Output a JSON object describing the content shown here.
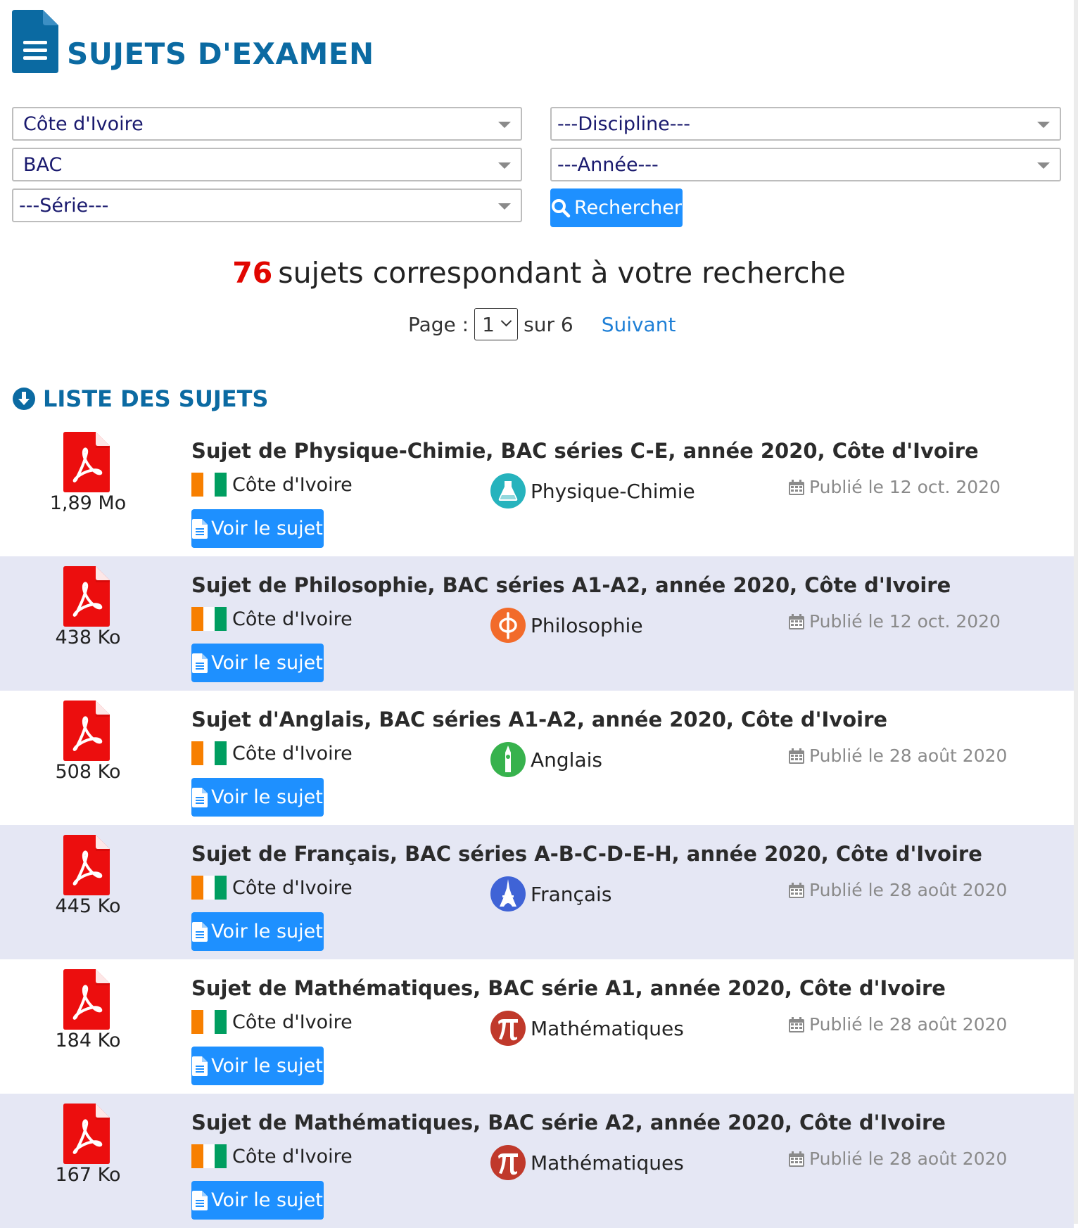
{
  "header": {
    "title": "SUJETS D'EXAMEN",
    "icon": "document-icon"
  },
  "filters": {
    "country": "Côte d'Ivoire",
    "exam": "BAC",
    "serie": "---Série---",
    "discipline": "---Discipline---",
    "annee": "---Année---",
    "search_label": "Recherche­r"
  },
  "results": {
    "count": "76",
    "text": "sujets correspondant à votre recherche"
  },
  "pager": {
    "label": "Page :",
    "current": "1",
    "of": "sur 6",
    "next": "Suivant"
  },
  "list": {
    "heading": "LISTE DES SUJETS",
    "view_label": "Voir le sujet"
  },
  "colors": {
    "primary": "#1e90ff",
    "title_blue": "#0b6aa2",
    "count_red": "#e10600",
    "alt_row": "#e5e7f4"
  },
  "items": [
    {
      "title": "Sujet de Physique-Chimie, BAC séries C-E, année 2020, Côte d'Ivoire",
      "size": "1,89 Mo",
      "country": "Côte d'Ivoire",
      "discipline": "Physique-Chimie",
      "discipline_icon": "flask-icon",
      "published": "Publié le 12 oct. 2020"
    },
    {
      "title": "Sujet de Philosophie, BAC séries A1-A2, année 2020, Côte d'Ivoire",
      "size": "438 Ko",
      "country": "Côte d'Ivoire",
      "discipline": "Philosophie",
      "discipline_icon": "phi-icon",
      "published": "Publié le 12 oct. 2020"
    },
    {
      "title": "Sujet d'Anglais, BAC séries A1-A2, année 2020, Côte d'Ivoire",
      "size": "508 Ko",
      "country": "Côte d'Ivoire",
      "discipline": "Anglais",
      "discipline_icon": "big-ben-icon",
      "published": "Publié le 28 août 2020"
    },
    {
      "title": "Sujet de Français, BAC séries A-B-C-D-E-H, année 2020, Côte d'Ivoire",
      "size": "445 Ko",
      "country": "Côte d'Ivoire",
      "discipline": "Français",
      "discipline_icon": "eiffel-tower-icon",
      "published": "Publié le 28 août 2020"
    },
    {
      "title": "Sujet de Mathématiques, BAC série A1, année 2020, Côte d'Ivoire",
      "size": "184 Ko",
      "country": "Côte d'Ivoire",
      "discipline": "Mathématiques",
      "discipline_icon": "pi-icon",
      "published": "Publié le 28 août 2020"
    },
    {
      "title": "Sujet de Mathématiques, BAC série A2, année 2020, Côte d'Ivoire",
      "size": "167 Ko",
      "country": "Côte d'Ivoire",
      "discipline": "Mathématiques",
      "discipline_icon": "pi-icon",
      "published": "Publié le 28 août 2020"
    }
  ]
}
